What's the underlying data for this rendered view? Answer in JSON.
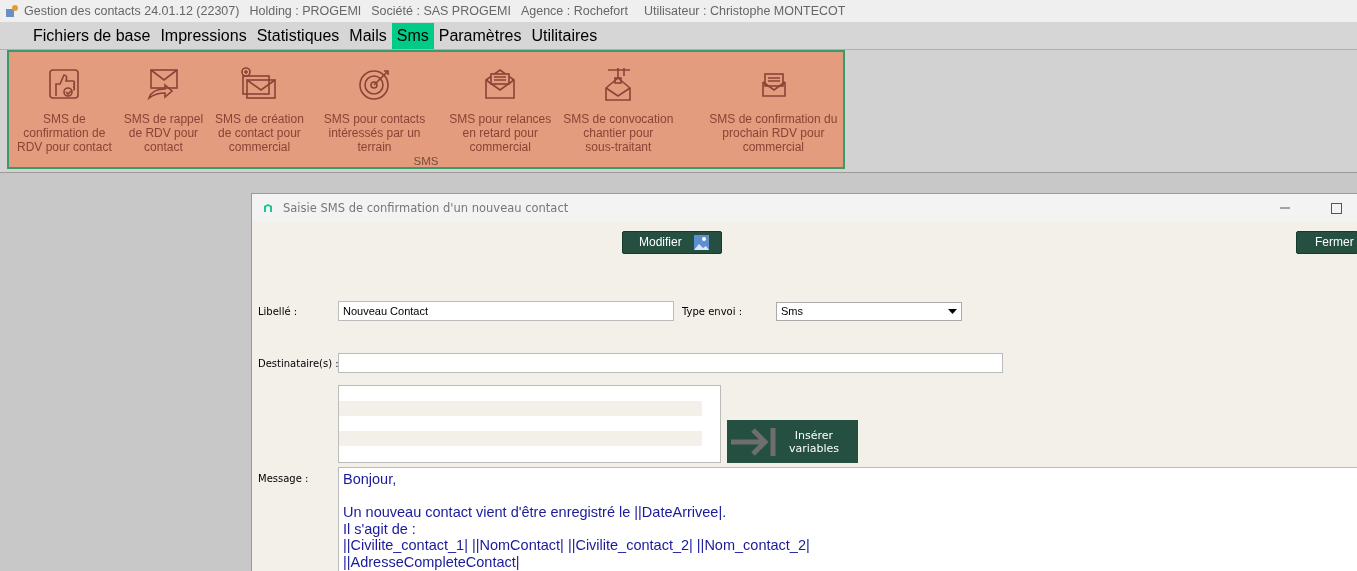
{
  "window": {
    "title": "Gestion des contacts 24.01.12 (22307)",
    "info": [
      "Holding : PROGEMI",
      "Société : SAS PROGEMI",
      "Agence : Rochefort",
      "Utilisateur : Christophe MONTECOT"
    ]
  },
  "menu": [
    {
      "label": "Fichiers de base",
      "selected": false
    },
    {
      "label": "Impressions",
      "selected": false
    },
    {
      "label": "Statistiques",
      "selected": false
    },
    {
      "label": "Mails",
      "selected": false
    },
    {
      "label": "Sms",
      "selected": true
    },
    {
      "label": "Paramètres",
      "selected": false
    },
    {
      "label": "Utilitaires",
      "selected": false
    }
  ],
  "ribbon": {
    "group_label": "SMS",
    "items": [
      {
        "label": "SMS de\nconfirmation de\nRDV pour contact"
      },
      {
        "label": "SMS de rappel\nde RDV pour\ncontact"
      },
      {
        "label": "SMS de création\nde contact pour\ncommercial"
      },
      {
        "label": "SMS pour contacts\nintéressés par un\nterrain"
      },
      {
        "label": "SMS pour relances\nen retard pour\ncommercial"
      },
      {
        "label": "SMS de convocation\nchantier pour\nsous-traitant"
      },
      {
        "label": "SMS de confirmation du\nprochain RDV pour\ncommercial"
      }
    ]
  },
  "dialog": {
    "title": "Saisie SMS de confirmation d'un nouveau contact",
    "modify_button": "Modifier",
    "close_button": "Fermer",
    "libelle": {
      "label": "Libellé :",
      "value": "Nouveau Contact"
    },
    "type_envoi": {
      "label": "Type envoi :",
      "value": "Sms"
    },
    "destinataires": {
      "label": "Destinataire(s) :"
    },
    "insert_button": "Insérer variables",
    "message": {
      "label": "Message :",
      "value": "Bonjour,\n\nUn nouveau contact vient d'être enregistré le ||DateArrivee|.\nIl s'agit de :\n||Civilite_contact_1| ||NomContact| ||Civilite_contact_2| ||Nom_contact_2|\n||AdresseCompleteContact|"
    }
  }
}
